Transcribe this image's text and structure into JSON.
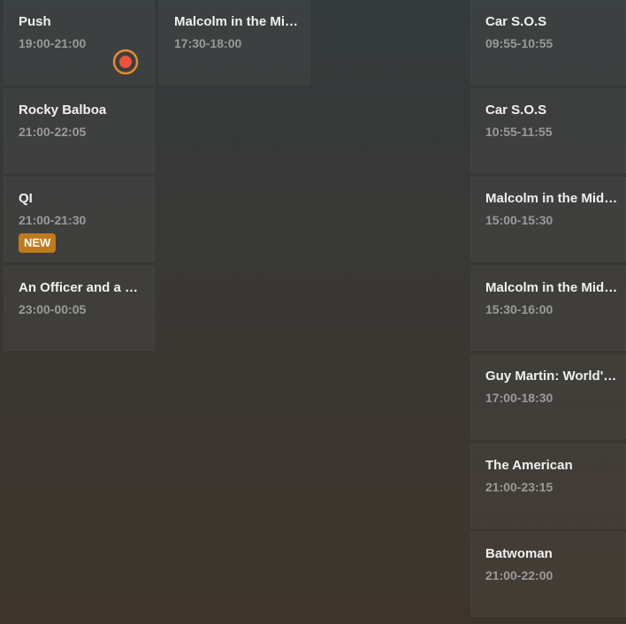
{
  "colors": {
    "accent": "#e6892f",
    "record_dot": "#f0523a",
    "badge_bg": "#c07a1e"
  },
  "columns": [
    {
      "programs": [
        {
          "title": "Push",
          "time": "19:00-21:00",
          "icon": "record-icon"
        },
        {
          "title": "Rocky Balboa",
          "time": "21:00-22:05"
        },
        {
          "title": "QI",
          "time": "21:00-21:30",
          "badge": "NEW"
        },
        {
          "title": "An Officer and a Gentleman",
          "time": "23:00-00:05"
        }
      ]
    },
    {
      "programs": [
        {
          "title": "Malcolm in the Middle",
          "time": "17:30-18:00"
        }
      ]
    },
    {
      "programs": [
        {
          "title": "Car S.O.S",
          "time": "09:55-10:55"
        },
        {
          "title": "Car S.O.S",
          "time": "10:55-11:55"
        },
        {
          "title": "Malcolm in the Middle",
          "time": "15:00-15:30"
        },
        {
          "title": "Malcolm in the Middle",
          "time": "15:30-16:00"
        },
        {
          "title": "Guy Martin: World's Fastest",
          "time": "17:00-18:30"
        },
        {
          "title": "The American",
          "time": "21:00-23:15"
        },
        {
          "title": "Batwoman",
          "time": "21:00-22:00"
        }
      ]
    }
  ]
}
